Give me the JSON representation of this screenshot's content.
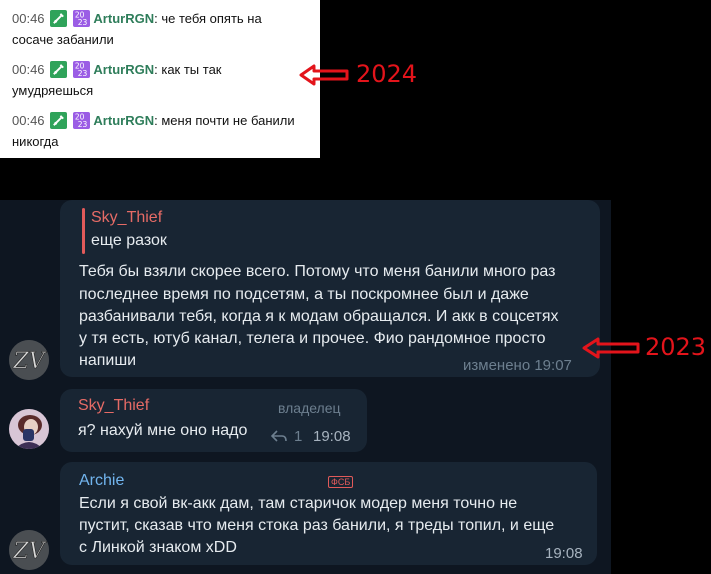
{
  "chat_2024": {
    "messages": [
      {
        "time": "00:46",
        "user": "ArturRGN",
        "colon": ":",
        "text_line1": "че тебя опять на",
        "text_line2": "сосаче забанили"
      },
      {
        "time": "00:46",
        "user": "ArturRGN",
        "colon": ":",
        "text_line1": "как ты так",
        "text_line2": "умудряешься"
      },
      {
        "time": "00:46",
        "user": "ArturRGN",
        "colon": ":",
        "text_line1": "меня почти не банили",
        "text_line2": "никогда"
      }
    ],
    "badge_icons": [
      "sword-badge-icon",
      "2023-badge-icon"
    ]
  },
  "labels": {
    "year_top": "2024",
    "year_bottom": "2023"
  },
  "telegram_2023": {
    "message1": {
      "reply_author": "Sky_Thief",
      "reply_text": "еще разок",
      "lines": [
        "Тебя бы взяли скорее всего. Потому что меня банили много раз",
        "последнее время по подсетям, а ты поскромнее был и даже",
        "разбанивали тебя, когда я к модам обращался. И акк в соцсетях",
        "у тя есть, ютуб канал, телега и прочее. Фио рандомное просто",
        "напиши"
      ],
      "edited_label": "изменено",
      "time": "19:07",
      "avatar_label": "ZV"
    },
    "message2": {
      "author": "Sky_Thief",
      "role": "владелец",
      "text": "я? нахуй мне оно надо",
      "reply_count": "1",
      "time": "19:08"
    },
    "message3": {
      "author": "Archie",
      "tag": "ФСБ",
      "lines": [
        "Если я свой вк-акк дам, там старичок модер меня точно не",
        "пустит, сказав что меня стока раз банили, я треды топил, и еще",
        "с Линкой знаком xDD"
      ],
      "time": "19:08",
      "avatar_label": "ZV"
    }
  },
  "colors": {
    "arrow_red": "#e3141b",
    "tg_bg": "#0e1621",
    "bubble_bg": "#182533",
    "name_red": "#e66b66",
    "name_blue": "#72b5ef",
    "twitch_user": "#2e7d5a"
  }
}
